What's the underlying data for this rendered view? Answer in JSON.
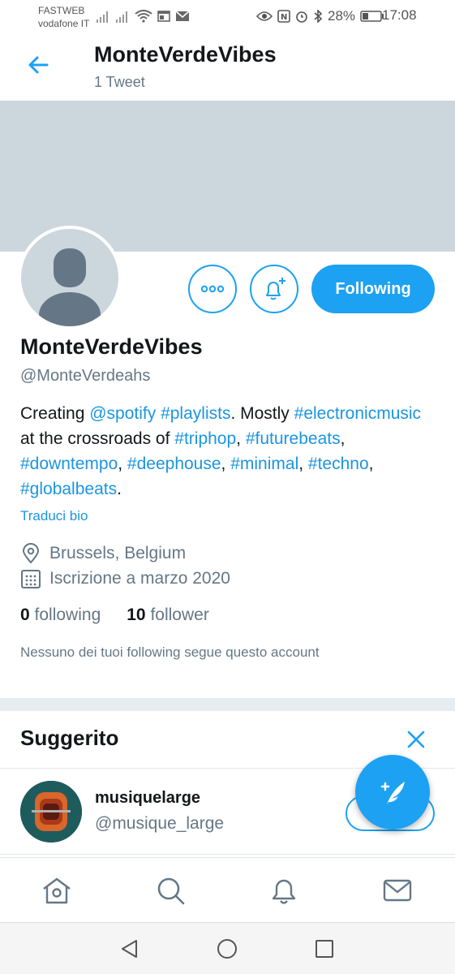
{
  "status_bar": {
    "carrier_1": "FASTWEB",
    "carrier_2": "vodafone IT",
    "battery": "28%",
    "time": "17:08"
  },
  "header": {
    "title": "MonteVerdeVibes",
    "subtitle": "1 Tweet"
  },
  "profile": {
    "follow_label": "Following",
    "name": "MonteVerdeVibes",
    "handle": "@MonteVerdeahs",
    "bio": {
      "t1": "Creating ",
      "l1": "@spotify",
      "t2": " ",
      "l2": "#playlists",
      "t3": ". Mostly ",
      "l3": "#electronicmusic",
      "t4": " at the crossroads of ",
      "l4": "#triphop",
      "t5": ", ",
      "l5": "#futurebeats",
      "t6": ", ",
      "l6": "#downtempo",
      "t7": ", ",
      "l7": "#deephouse",
      "t8": ", ",
      "l8": "#minimal",
      "t9": ", ",
      "l9": "#techno",
      "t10": ", ",
      "l10": "#globalbeats",
      "t11": "."
    },
    "translate_label": "Traduci bio",
    "location": "Brussels, Belgium",
    "joined": "Iscrizione a marzo 2020",
    "following_count": "0",
    "following_label": "following",
    "follower_count": "10",
    "follower_label": "follower",
    "no_mutuals": "Nessuno dei tuoi following segue questo account"
  },
  "suggested": {
    "title": "Suggerito",
    "account_name": "musiquelarge",
    "account_handle": "@musique_large"
  },
  "colors": {
    "accent": "#1da1f2",
    "link": "#1b95e0",
    "secondary_text": "#657786",
    "banner": "#ccd6dd"
  },
  "icons": {
    "back": "arrow-left-icon",
    "more": "more-dots-icon",
    "notify": "bell-plus-icon",
    "location": "location-pin-icon",
    "calendar": "calendar-icon",
    "close": "close-icon",
    "compose": "compose-feather-icon",
    "home": "home-icon",
    "search": "search-icon",
    "notifications": "bell-icon",
    "messages": "mail-icon"
  }
}
